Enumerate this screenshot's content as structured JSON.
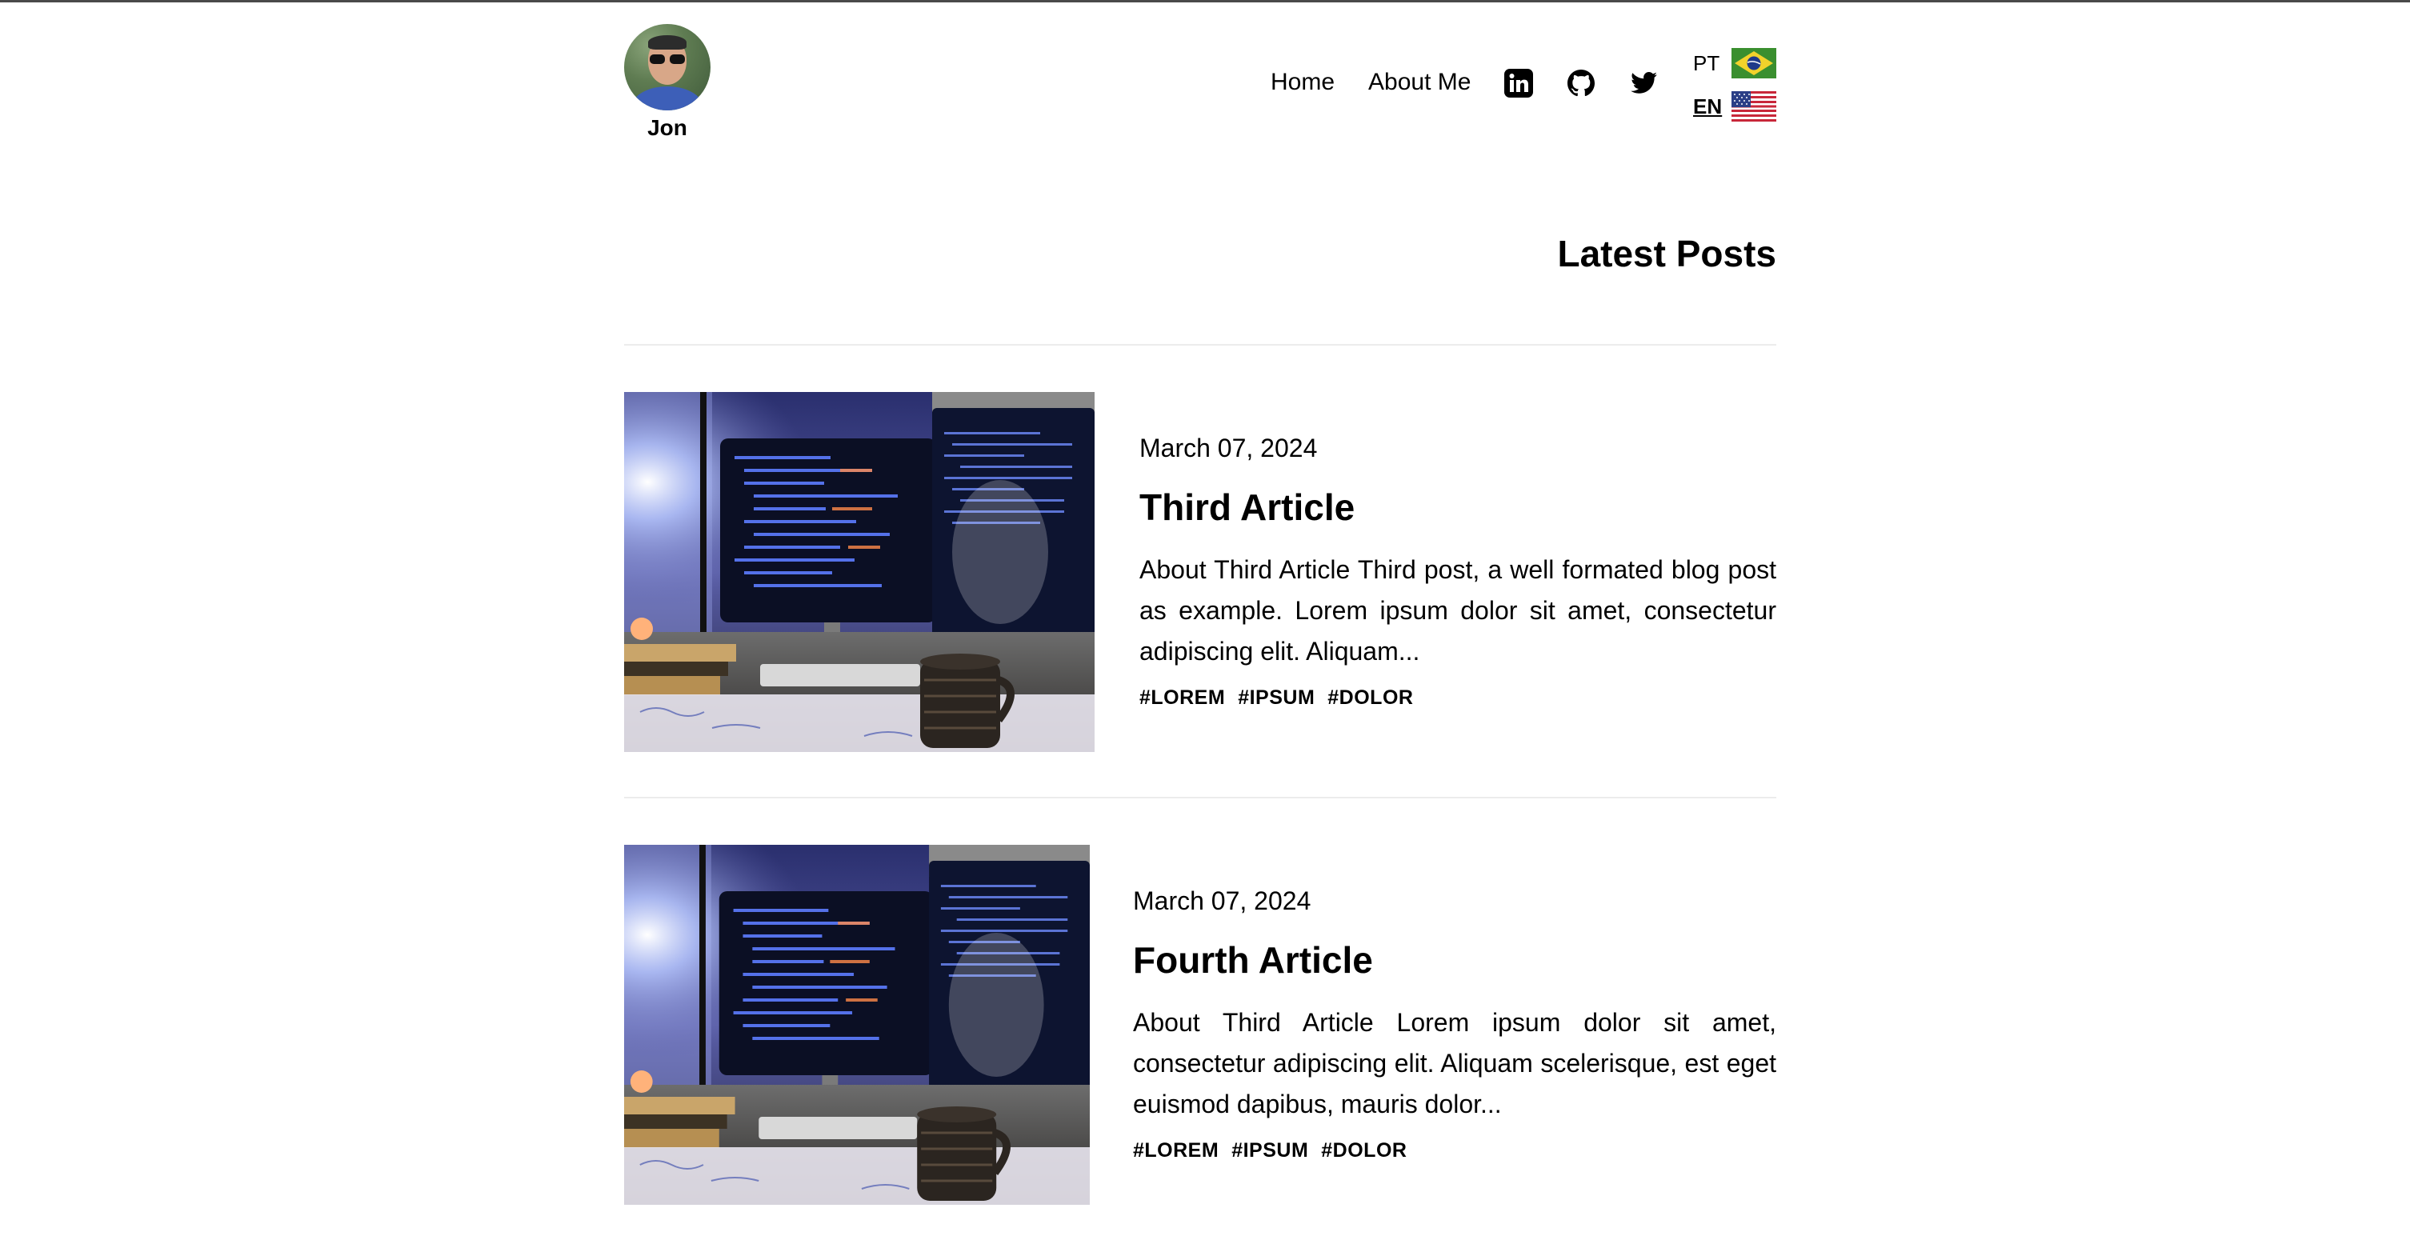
{
  "header": {
    "name": "Jon",
    "nav": {
      "home": "Home",
      "about": "About Me"
    },
    "social": [
      "linkedin-icon",
      "github-icon",
      "twitter-icon"
    ],
    "languages": [
      {
        "code": "PT",
        "flag": "brazil-flag",
        "active": false
      },
      {
        "code": "EN",
        "flag": "usa-flag",
        "active": true
      }
    ]
  },
  "main": {
    "section_title": "Latest Posts",
    "posts": [
      {
        "date": "March 07, 2024",
        "title": "Third Article",
        "excerpt": "About Third Article Third post, a well formated blog post as example. Lorem ipsum dolor sit amet, consectetur adipiscing elit. Aliquam...",
        "tags": [
          "#LOREM",
          "#IPSUM",
          "#DOLOR"
        ]
      },
      {
        "date": "March 07, 2024",
        "title": "Fourth Article",
        "excerpt": "About Third Article Lorem ipsum dolor sit amet, consectetur adipiscing elit. Aliquam scelerisque, est eget euismod dapibus, mauris dolor...",
        "tags": [
          "#LOREM",
          "#IPSUM",
          "#DOLOR"
        ]
      }
    ]
  },
  "colors": {
    "text": "#000000",
    "divider": "#ececec",
    "background": "#ffffff"
  }
}
